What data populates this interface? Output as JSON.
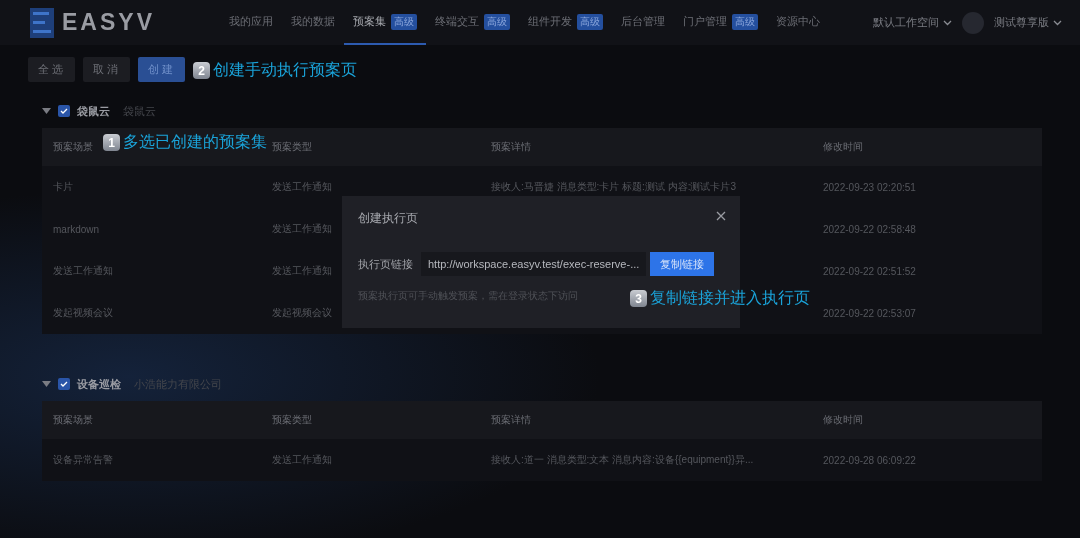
{
  "header": {
    "logo": "EASYV",
    "nav": [
      {
        "label": "我的应用",
        "selected": false
      },
      {
        "label": "我的数据",
        "selected": false
      },
      {
        "label": "预案集",
        "badge": "高级",
        "selected": true
      },
      {
        "label": "终端交互",
        "badge": "高级",
        "selected": false
      },
      {
        "label": "组件开发",
        "badge": "高级",
        "selected": false
      },
      {
        "label": "后台管理",
        "selected": false
      },
      {
        "label": "门户管理",
        "badge": "高级",
        "selected": false
      },
      {
        "label": "资源中心",
        "selected": false
      }
    ],
    "workspace": "默认工作空间",
    "user": "测试尊享版"
  },
  "toolbar": {
    "buttons": [
      {
        "label": "全选",
        "kind": "default"
      },
      {
        "label": "取消",
        "kind": "default"
      },
      {
        "label": "创建",
        "kind": "primary"
      }
    ]
  },
  "groups": [
    {
      "name": "袋鼠云",
      "subtitle": "袋鼠云",
      "expanded": true,
      "checked": true,
      "columns": [
        "预案场景",
        "预案类型",
        "预案详情",
        "修改时间"
      ],
      "rows": [
        [
          "卡片",
          "发送工作通知",
          "接收人:马晋婕 消息类型:卡片 标题:测试 内容:测试卡片3",
          "2022-09-23 02:20:51"
        ],
        [
          "markdown",
          "发送工作通知",
          "",
          "2022-09-22 02:58:48"
        ],
        [
          "发送工作通知",
          "发送工作通知",
          "",
          "2022-09-22 02:51:52"
        ],
        [
          "发起视频会议",
          "发起视频会议",
          "",
          "2022-09-22 02:53:07"
        ]
      ]
    },
    {
      "name": "设备巡检",
      "subtitle": "小浩能力有限公司",
      "expanded": true,
      "checked": true,
      "columns": [
        "预案场景",
        "预案类型",
        "预案详情",
        "修改时间"
      ],
      "rows": [
        [
          "设备异常告警",
          "发送工作通知",
          "接收人:道一 消息类型:文本 消息内容:设备{{equipment}}异...",
          "2022-09-28 06:09:22"
        ]
      ]
    }
  ],
  "dialog": {
    "title": "创建执行页",
    "field_label": "执行页链接",
    "link": "http://workspace.easyv.test/exec-reserve-...",
    "copy_button": "复制链接",
    "hint": "预案执行页可手动触发预案，需在登录状态下访问"
  },
  "annotations": [
    {
      "number": "1",
      "text": "多选已创建的预案集"
    },
    {
      "number": "2",
      "text": "创建手动执行预案页"
    },
    {
      "number": "3",
      "text": "复制链接并进入执行页"
    }
  ]
}
